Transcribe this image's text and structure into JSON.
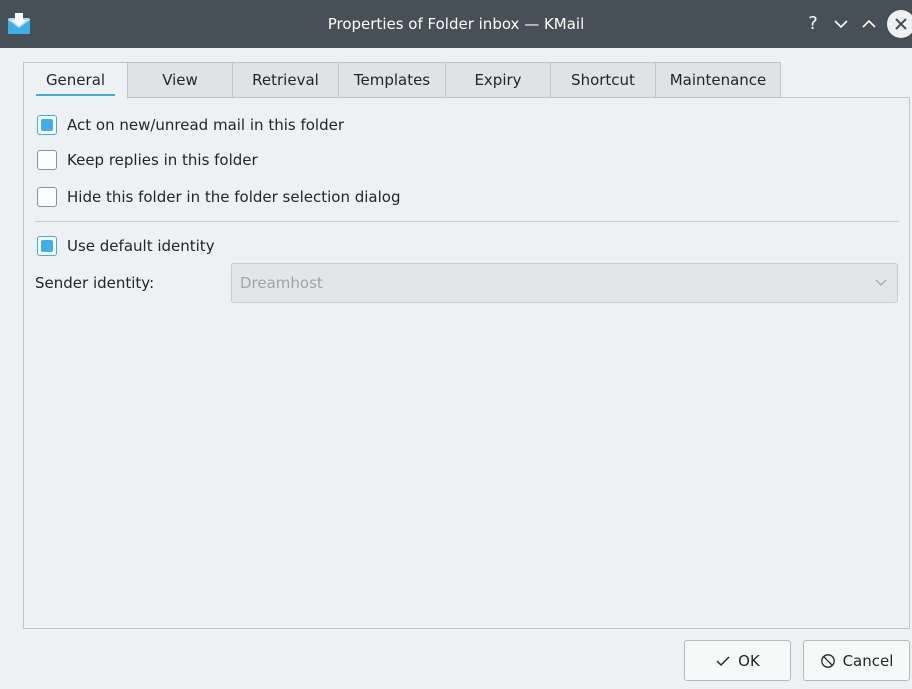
{
  "window": {
    "title": "Properties of Folder inbox — KMail",
    "help_glyph": "?"
  },
  "tabs": [
    {
      "label": "General",
      "active": true
    },
    {
      "label": "View",
      "active": false
    },
    {
      "label": "Retrieval",
      "active": false
    },
    {
      "label": "Templates",
      "active": false
    },
    {
      "label": "Expiry",
      "active": false
    },
    {
      "label": "Shortcut",
      "active": false
    },
    {
      "label": "Maintenance",
      "active": false
    }
  ],
  "general": {
    "options": [
      {
        "label": "Act on new/unread mail in this folder",
        "checked": true
      },
      {
        "label": "Keep replies in this folder",
        "checked": false
      },
      {
        "label": "Hide this folder in the folder selection dialog",
        "checked": false
      }
    ],
    "identity": {
      "use_default_label": "Use default identity",
      "use_default_checked": true,
      "sender_label": "Sender identity:",
      "sender_value": "Dreamhost",
      "sender_disabled": true
    }
  },
  "buttons": {
    "ok": "OK",
    "cancel": "Cancel"
  },
  "icons": {
    "app": "kmail-envelope-icon",
    "help": "help-icon",
    "minimize": "chevron-down-icon",
    "maximize": "chevron-up-icon",
    "close": "close-icon",
    "ok": "check-icon",
    "cancel": "cancel-icon",
    "combo": "chevron-down-icon"
  },
  "colors": {
    "titlebar": "#475057",
    "accent": "#3daee9",
    "window": "#eff0f1"
  }
}
